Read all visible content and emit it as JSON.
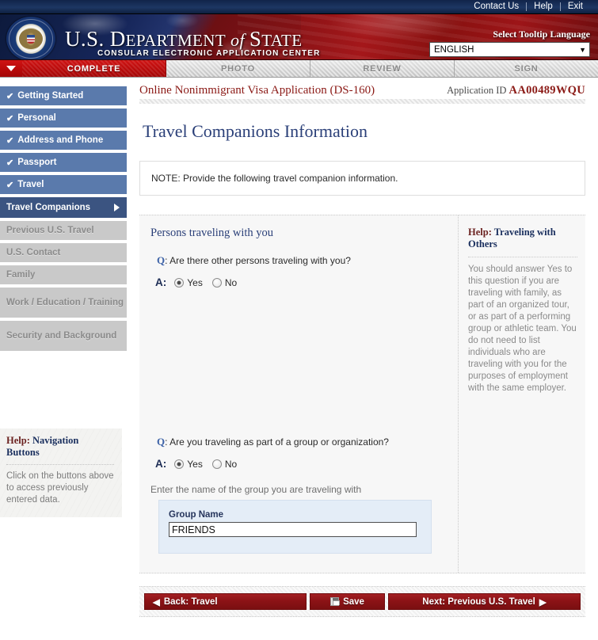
{
  "topbar": {
    "links": [
      "Contact Us",
      "Help",
      "Exit"
    ]
  },
  "banner": {
    "title_us": "U.S. ",
    "title_dept": "D",
    "title_dept_rest": "EPARTMENT",
    "title_of": " of ",
    "title_state": "S",
    "title_state_rest": "TATE",
    "subtitle": "CONSULAR ELECTRONIC APPLICATION CENTER",
    "tooltip_label": "Select Tooltip Language",
    "language_selected": "ENGLISH",
    "dropdown_icon": "chevron-down-icon"
  },
  "stages": [
    {
      "label": "COMPLETE",
      "active": true
    },
    {
      "label": "PHOTO",
      "active": false
    },
    {
      "label": "REVIEW",
      "active": false
    },
    {
      "label": "SIGN",
      "active": false
    }
  ],
  "sidebar": {
    "items": [
      {
        "label": "Getting Started",
        "state": "done",
        "check": "✔"
      },
      {
        "label": "Personal",
        "state": "done",
        "check": "✔"
      },
      {
        "label": "Address and Phone",
        "state": "done",
        "check": "✔"
      },
      {
        "label": "Passport",
        "state": "done",
        "check": "✔"
      },
      {
        "label": "Travel",
        "state": "done",
        "check": "✔"
      },
      {
        "label": "Travel Companions",
        "state": "current",
        "check": ""
      },
      {
        "label": "Previous U.S. Travel",
        "state": "disabled",
        "check": ""
      },
      {
        "label": "U.S. Contact",
        "state": "disabled",
        "check": ""
      },
      {
        "label": "Family",
        "state": "disabled",
        "check": ""
      },
      {
        "label": "Work / Education / Training",
        "state": "disabled",
        "check": ""
      },
      {
        "label": "Security and Background",
        "state": "disabled",
        "check": ""
      }
    ],
    "help": {
      "title_prefix": "Help:",
      "title_rest": " Navigation Buttons",
      "text": "Click on the buttons above to access previously entered data."
    }
  },
  "breadcrumb": {
    "app_name": "Online Nonimmigrant Visa Application (DS-160)",
    "app_id_label": "Application ID",
    "app_id_value": "AA00489WQU"
  },
  "page": {
    "title": "Travel Companions Information",
    "note": "NOTE: Provide the following travel companion information."
  },
  "form": {
    "section_head": "Persons traveling with you",
    "q1": {
      "marker": "Q",
      "text": "Are there other persons traveling with you?",
      "answer_marker": "A:",
      "options": [
        {
          "label": "Yes",
          "selected": true
        },
        {
          "label": "No",
          "selected": false
        }
      ]
    },
    "q2": {
      "marker": "Q",
      "text": "Are you traveling as part of a group or organization?",
      "answer_marker": "A:",
      "options": [
        {
          "label": "Yes",
          "selected": true
        },
        {
          "label": "No",
          "selected": false
        }
      ],
      "sub_label": "Enter the name of the group you are traveling with",
      "group_field_label": "Group Name",
      "group_field_value": "FRIENDS"
    }
  },
  "side_help": {
    "title_prefix": "Help:",
    "title_rest": " Traveling with Others",
    "text": "You should answer Yes to this question if you are traveling with family, as part of an organized tour, or as part of a performing group or athletic team. You do not need to list individuals who are traveling with you for the purposes of employment with the same employer."
  },
  "footer": {
    "back_label": "Back: Travel",
    "back_arrow": "◀",
    "save_label": "Save",
    "save_icon": "floppy-disk-icon",
    "next_label": "Next: Previous U.S. Travel",
    "next_arrow": "▶"
  },
  "colors": {
    "banner_red": "#8c1316",
    "nav_blue": "#5a7aac",
    "nav_current": "#3b5481",
    "title_blue": "#2a3f78",
    "crumb_red": "#8b1a16",
    "button_red": "#8c1316"
  }
}
